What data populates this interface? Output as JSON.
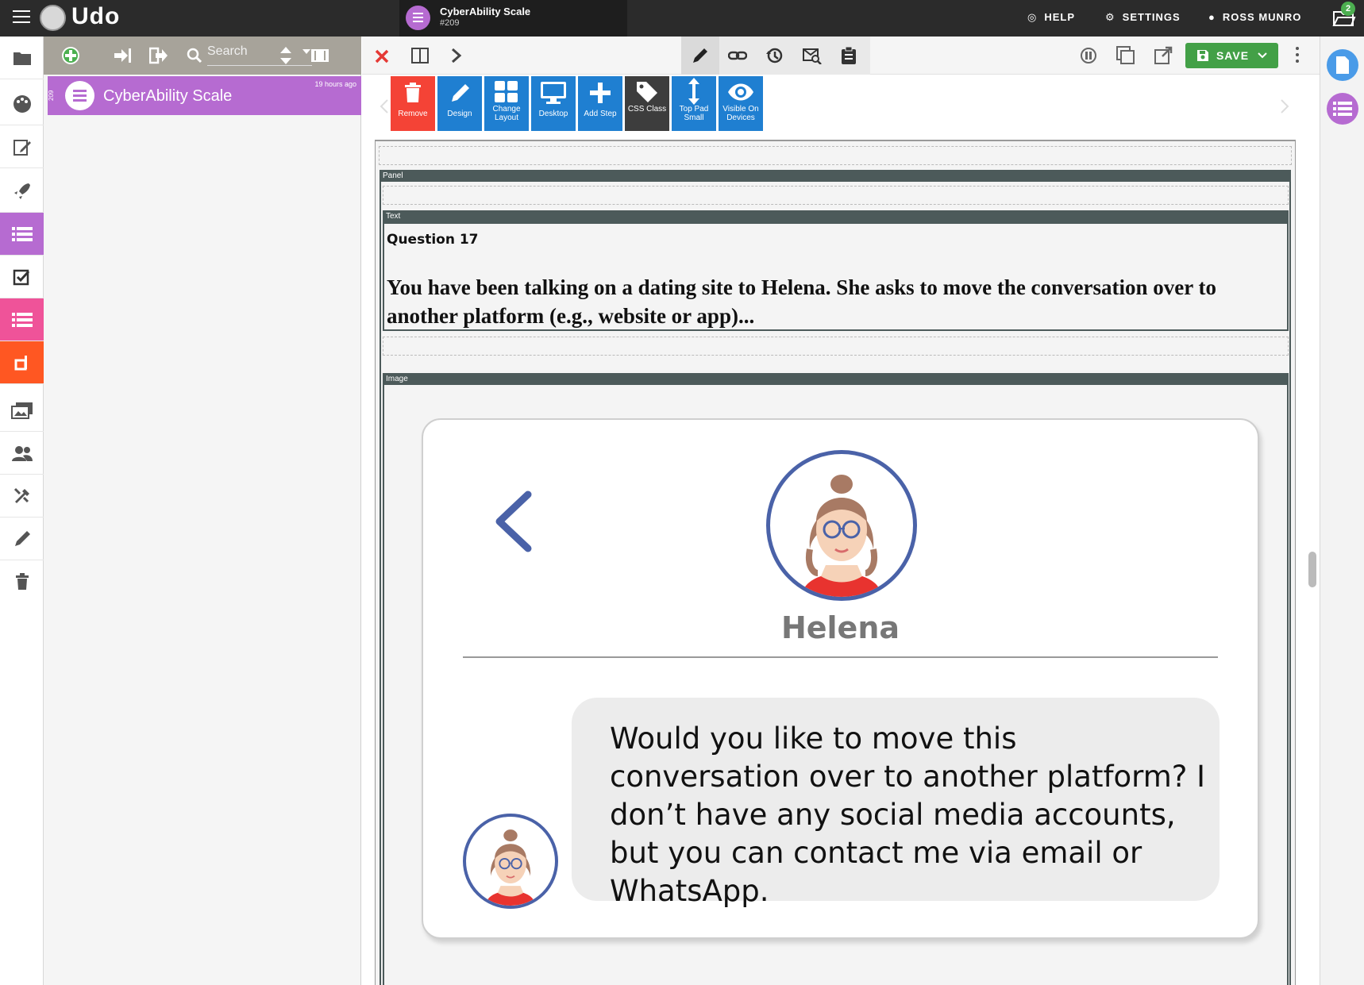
{
  "brand": {
    "name": "Udo"
  },
  "app_chip": {
    "title": "CyberAbility Scale",
    "id": "#209"
  },
  "top_nav": {
    "help": "HELP",
    "settings": "SETTINGS",
    "user": "ROSS MUNRO",
    "notifications": "2"
  },
  "tree": {
    "search_placeholder": "Search",
    "item": {
      "id": "209",
      "title": "CyberAbility Scale",
      "time": "19 hours ago"
    }
  },
  "toolbar": {
    "save_label": "SAVE"
  },
  "actions": [
    {
      "label": "Remove",
      "color": "#f44336",
      "icon": "trash-icon"
    },
    {
      "label": "Design",
      "color": "#1f7fd1",
      "icon": "pencil-icon"
    },
    {
      "label": "Change Layout",
      "color": "#1f7fd1",
      "icon": "grid-icon"
    },
    {
      "label": "Desktop",
      "color": "#1f7fd1",
      "icon": "monitor-icon"
    },
    {
      "label": "Add Step",
      "color": "#1f7fd1",
      "icon": "plus-icon"
    },
    {
      "label": "CSS Class",
      "color": "#3d3d3d",
      "icon": "tag-icon"
    },
    {
      "label": "Top Pad Small",
      "color": "#1f7fd1",
      "icon": "vertical-arrows-icon"
    },
    {
      "label": "Visible On Devices",
      "color": "#1f7fd1",
      "icon": "eye-icon"
    }
  ],
  "canvas": {
    "panel_label": "Panel",
    "text_label": "Text",
    "image_label": "Image",
    "question_title": "Question 17",
    "question_body": "You have been talking on a dating site to Helena. She asks to move the conversation over to another platform (e.g., website or app)...",
    "chat": {
      "name": "Helena",
      "message": "Would you like to move this conversation over to another platform? I don’t have any social media accounts, but you can contact me via email or WhatsApp."
    }
  },
  "colors": {
    "topbar": "#2b2b2b",
    "accent_purple": "#b66bd1",
    "save_green": "#43a047",
    "action_blue": "#1f7fd1",
    "remove_red": "#f44336",
    "avatar_ring": "#4a62a8"
  }
}
